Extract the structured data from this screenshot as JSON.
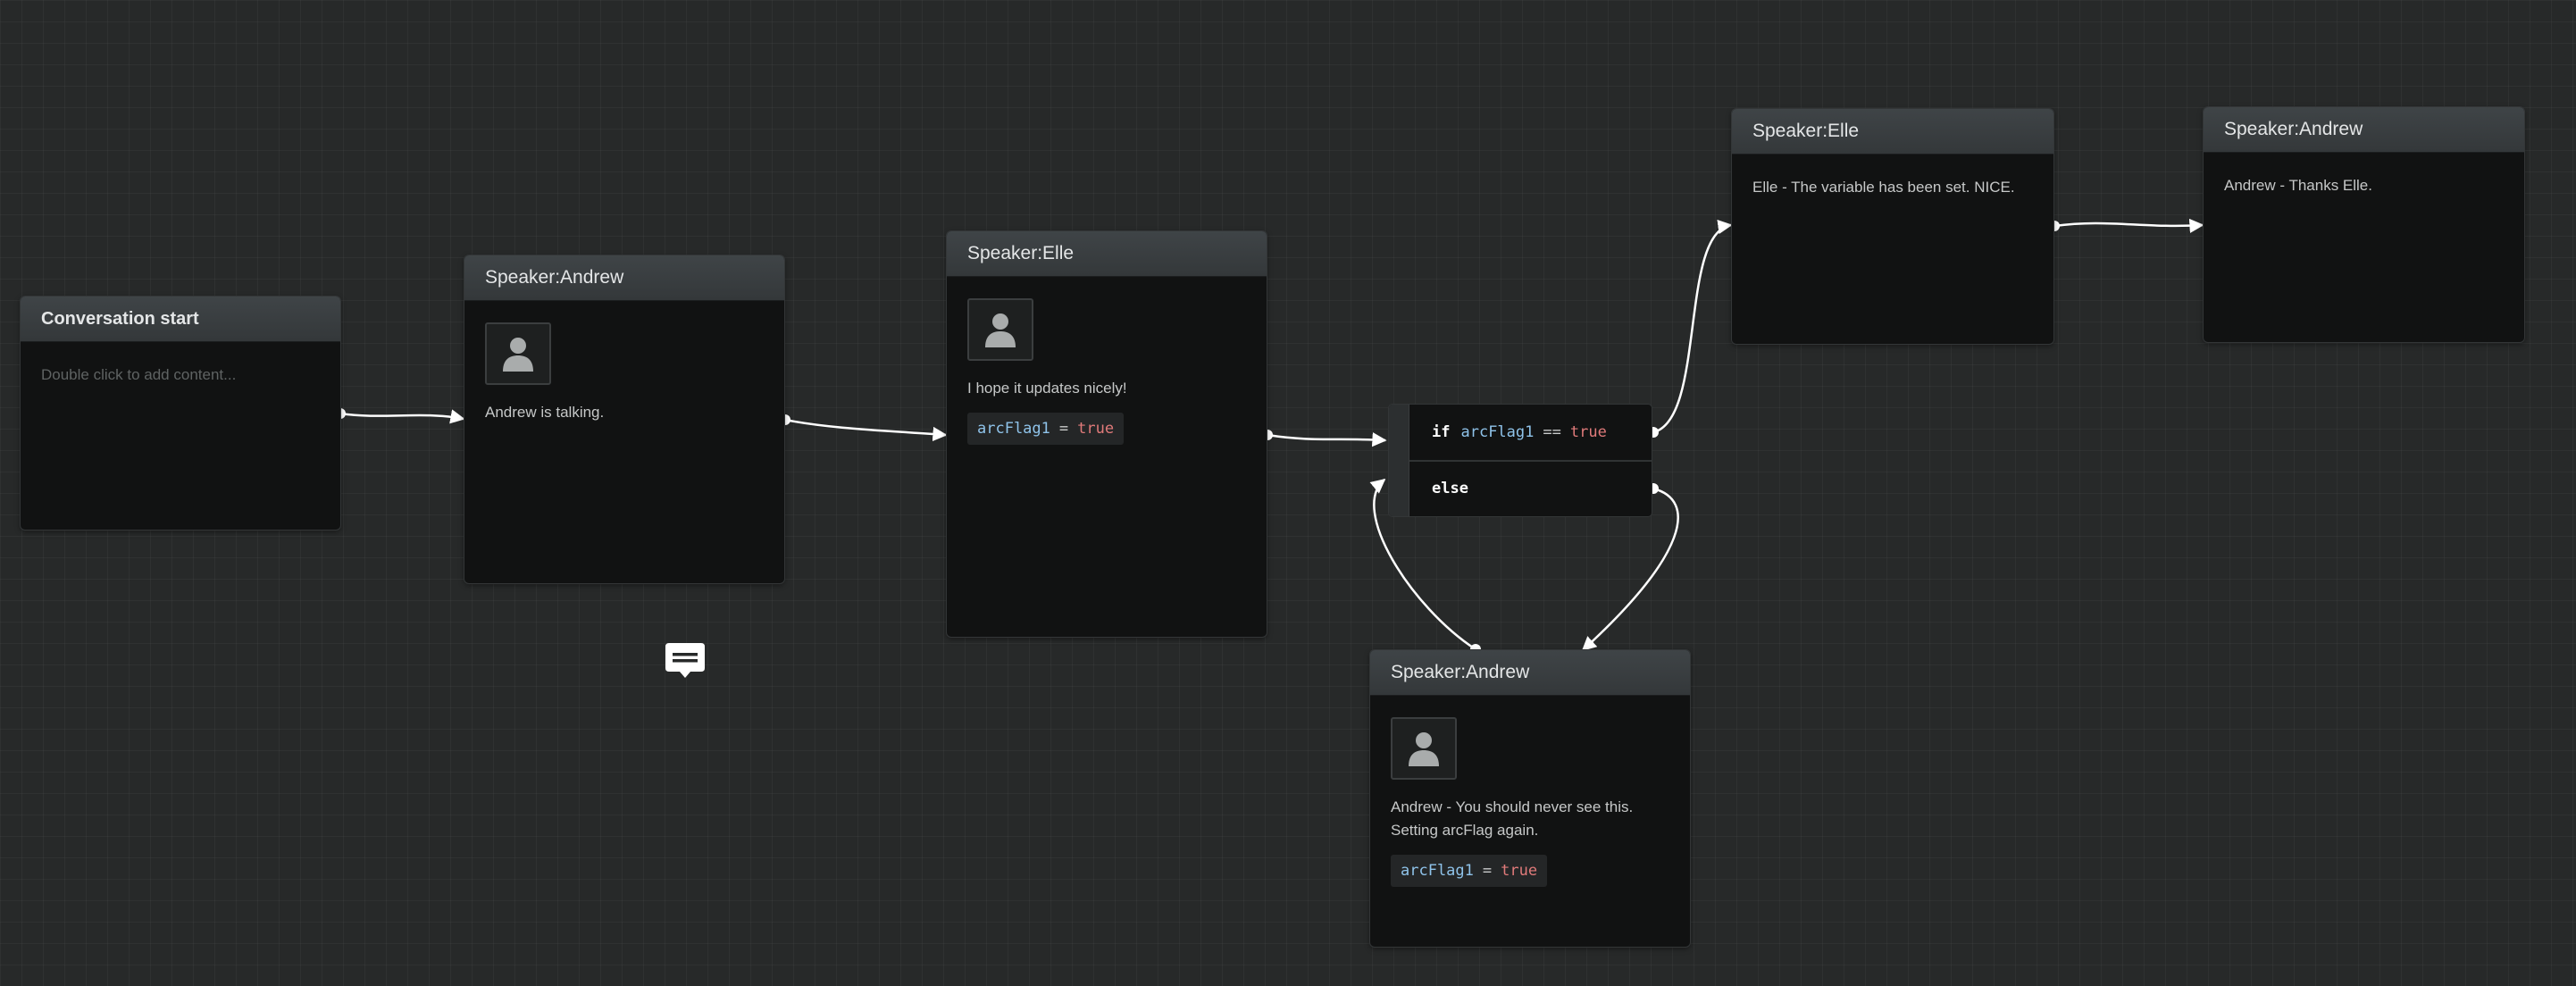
{
  "nodes": {
    "start": {
      "title": "Conversation start",
      "placeholder": "Double click to add content..."
    },
    "andrew1": {
      "title": "Speaker:Andrew",
      "text": "Andrew is talking."
    },
    "elle1": {
      "title": "Speaker:Elle",
      "text": "I hope it updates nicely!",
      "code_var": "arcFlag1",
      "code_op": "=",
      "code_val": "true"
    },
    "branch": {
      "if_kw": "if",
      "if_var": "arcFlag1",
      "if_op": "==",
      "if_val": "true",
      "else_kw": "else"
    },
    "andrew2": {
      "title": "Speaker:Andrew",
      "line1": "Andrew - You should never see this.",
      "line2": "Setting arcFlag again.",
      "code_var": "arcFlag1",
      "code_op": "=",
      "code_val": "true"
    },
    "elle2": {
      "title": "Speaker:Elle",
      "text": "Elle - The variable has been set. NICE."
    },
    "andrew3": {
      "title": "Speaker:Andrew",
      "text": "Andrew - Thanks Elle."
    }
  },
  "icons": {
    "avatar": "person-silhouette-icon",
    "comment": "comment-icon"
  },
  "colors": {
    "canvas_bg": "#272929",
    "node_bg": "#111212",
    "header_bg": "#3a3f42",
    "variable": "#8fc3ea",
    "boolean_true": "#e07a7a",
    "connector": "#ffffff"
  }
}
